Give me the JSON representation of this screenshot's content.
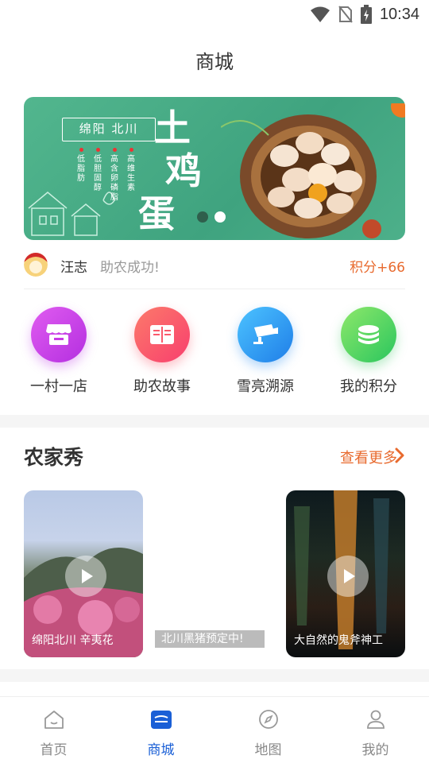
{
  "status_bar": {
    "time": "10:34",
    "icons": [
      "wifi-icon",
      "no-sim-icon",
      "battery-charging-icon"
    ]
  },
  "page": {
    "title": "商城"
  },
  "banner": {
    "sign": "绵阳 北川",
    "tags": [
      "低脂肪",
      "低胆固醇",
      "高含卵磷脂",
      "高维生素"
    ],
    "headline": [
      "土",
      "鸡",
      "蛋"
    ],
    "slide_count": 2,
    "active_slide": 2,
    "colors": {
      "background": "#4db08a"
    }
  },
  "notice": {
    "name": "汪志",
    "message": "助农成功!",
    "points": "积分+66"
  },
  "quick_menu": [
    {
      "label": "一村一店",
      "icon": "shop-icon",
      "color": "#c93ae6"
    },
    {
      "label": "助农故事",
      "icon": "book-icon",
      "color": "#fa5a6c"
    },
    {
      "label": "雪亮溯源",
      "icon": "camera-icon",
      "color": "#2a9cf2"
    },
    {
      "label": "我的积分",
      "icon": "coins-icon",
      "color": "#3ed46a"
    }
  ],
  "farm_section": {
    "title": "农家秀",
    "more": "查看更多",
    "videos": [
      {
        "caption": "绵阳北川 辛夷花"
      },
      {
        "caption": "北川黑猪预定中!"
      },
      {
        "caption": "大自然的鬼斧神工"
      }
    ]
  },
  "bottom_nav": {
    "items": [
      {
        "label": "首页",
        "icon": "home-icon"
      },
      {
        "label": "商城",
        "icon": "store-icon"
      },
      {
        "label": "地图",
        "icon": "compass-icon"
      },
      {
        "label": "我的",
        "icon": "user-icon"
      }
    ],
    "active": "商城",
    "colors": {
      "active": "#1a5fd6",
      "inactive": "#888888"
    }
  }
}
